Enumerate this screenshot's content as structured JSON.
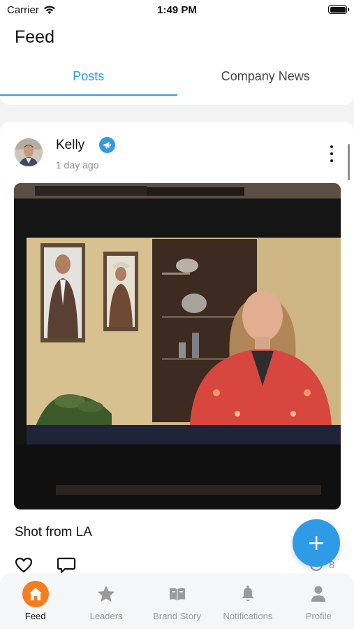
{
  "status_bar": {
    "carrier": "Carrier",
    "time": "1:49 PM"
  },
  "header": {
    "title": "Feed",
    "tabs": [
      {
        "label": "Posts",
        "active": true
      },
      {
        "label": "Company News",
        "active": false
      }
    ]
  },
  "post": {
    "author": "Kelly",
    "time_ago": "1 day ago",
    "caption": "Shot from LA",
    "views": "8"
  },
  "bottom_nav": {
    "items": [
      {
        "label": "Feed",
        "icon": "home-icon",
        "active": true
      },
      {
        "label": "Leaders",
        "icon": "star-icon",
        "active": false
      },
      {
        "label": "Brand Story",
        "icon": "book-icon",
        "active": false
      },
      {
        "label": "Notifications",
        "icon": "bell-icon",
        "active": false
      },
      {
        "label": "Profile",
        "icon": "person-icon",
        "active": false
      }
    ]
  },
  "colors": {
    "accent": "#2f9be6",
    "feed_active": "#f57c1f",
    "inactive": "#9a9a9a"
  }
}
